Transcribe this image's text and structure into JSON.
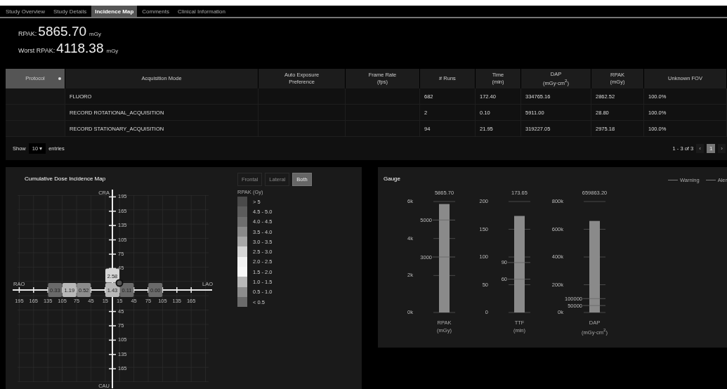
{
  "tabs": [
    {
      "label": "Study Overview",
      "selected": false
    },
    {
      "label": "Study Details",
      "selected": false
    },
    {
      "label": "Incidence Map",
      "selected": true
    },
    {
      "label": "Comments",
      "selected": false
    },
    {
      "label": "Clinical Information",
      "selected": false
    }
  ],
  "summary": [
    {
      "label": "RPAK:",
      "value": "5865.70",
      "unit": "mGy"
    },
    {
      "label": "Worst RPAK:",
      "value": "4118.38",
      "unit": "mGy"
    }
  ],
  "table": {
    "columns": [
      {
        "label": "Protocol",
        "sorted": true
      },
      {
        "label": "Acquisition Mode",
        "sorted": false
      },
      {
        "label": "Auto Exposure\nPreference",
        "sorted": false
      },
      {
        "label": "Frame Rate\n(fps)",
        "sorted": false
      },
      {
        "label": "# Runs",
        "sorted": false
      },
      {
        "label": "Time\n(min)",
        "sorted": false
      },
      {
        "label": "DAP\n(mGy·cm$^{2}$)",
        "sorted": false
      },
      {
        "label": "RPAK\n(mGy)",
        "sorted": false
      },
      {
        "label": "Unknown FOV",
        "sorted": false
      }
    ],
    "rows": [
      {
        "cells": [
          null,
          "FLUORO",
          null,
          null,
          "682",
          "172.40",
          "334765.16",
          "2862.52",
          "100.0%"
        ]
      },
      {
        "cells": [
          null,
          "RECORD ROTATIONAL_ACQUISITION",
          null,
          null,
          "2",
          "0.10",
          "5911.00",
          "28.80",
          "100.0%"
        ]
      },
      {
        "cells": [
          null,
          "RECORD STATIONARY_ACQUISITION",
          null,
          null,
          "94",
          "21.95",
          "319227.05",
          "2975.18",
          "100.0%"
        ]
      }
    ]
  },
  "page_length": {
    "label_before": "Show",
    "value": "10",
    "caret": "▾",
    "label_after": "entries"
  },
  "pagination": {
    "info": "1 - 3 of 3",
    "prev": "‹",
    "pages": [
      {
        "label": "1",
        "selected": true
      }
    ],
    "next": "›"
  },
  "incidence_map": {
    "title": "Cumulative Dose Incidence Map",
    "views": [
      {
        "label": "Frontal",
        "selected": false
      },
      {
        "label": "Lateral",
        "selected": false
      },
      {
        "label": "Both",
        "selected": true
      }
    ],
    "axis_labels": {
      "left": "RAO",
      "right": "LAO",
      "top": "CRA",
      "bottom": "CAU"
    },
    "horizontal_ticks": [
      "195",
      "165",
      "135",
      "105",
      "75",
      "45",
      "15",
      "15",
      "45",
      "75",
      "105",
      "135",
      "165"
    ],
    "upper_ticks": [
      "195",
      "165",
      "135",
      "105",
      "75",
      "45"
    ],
    "lower_ticks": [
      "45",
      "75",
      "105",
      "135",
      "165"
    ],
    "horizontal_cells": [
      null,
      null,
      {
        "value": "0.33",
        "color": "#6a6a6a"
      },
      {
        "value": "1.19",
        "color": "#b8b8b8"
      },
      {
        "value": "0.52",
        "color": "#8c8c8c"
      },
      null,
      {
        "value": "1.43",
        "color": "#b8b8b8"
      },
      {
        "value": "0.11",
        "color": "#6a6a6a"
      },
      null,
      {
        "value": "0.00",
        "color": "#6a6a6a"
      },
      null,
      null
    ],
    "upper_cells": [
      {
        "value": "2.58",
        "color": "#d6d6d6"
      }
    ],
    "legend": {
      "title": "RPAK (Gy)",
      "items": [
        {
          "label": "> 5",
          "color": "#4a4a4a"
        },
        {
          "label": "4.5 - 5.0",
          "color": "#5c5c5c"
        },
        {
          "label": "4.0 - 4.5",
          "color": "#6e6e6e"
        },
        {
          "label": "3.5 - 4.0",
          "color": "#8a8a8a"
        },
        {
          "label": "3.0 - 3.5",
          "color": "#a8a8a8"
        },
        {
          "label": "2.5 - 3.0",
          "color": "#d6d6d6"
        },
        {
          "label": "2.0 - 2.5",
          "color": "#f2f2f2"
        },
        {
          "label": "1.5 - 2.0",
          "color": "#f8f8f8"
        },
        {
          "label": "1.0 - 1.5",
          "color": "#b8b8b8"
        },
        {
          "label": "0.5 - 1.0",
          "color": "#8c8c8c"
        },
        {
          "label": "< 0.5",
          "color": "#6a6a6a"
        }
      ]
    }
  },
  "gauge": {
    "title": "Gauge",
    "legend": [
      "Warning",
      "Aler"
    ],
    "gauges": [
      {
        "chart_data": {
          "type": "bar",
          "title": "5865.70",
          "categories": [
            "RPAK\n(mGy)"
          ],
          "values": [
            5866
          ],
          "ylim": [
            0,
            6000
          ],
          "yticks": [
            {
              "value": 0,
              "label": "0k"
            },
            {
              "value": 2000,
              "label": "2k"
            },
            {
              "value": 4000,
              "label": "4k"
            },
            {
              "value": 6000,
              "label": "6k"
            }
          ],
          "grid": true,
          "ref_lines": [
            {
              "axis": "y",
              "value": 5000,
              "label": "5000"
            },
            {
              "axis": "y",
              "value": 3000,
              "label": "3000"
            }
          ]
        }
      },
      {
        "chart_data": {
          "type": "bar",
          "title": "173.65",
          "categories": [
            "TTF\n(min)"
          ],
          "values": [
            174
          ],
          "ylim": [
            0,
            200
          ],
          "yticks": [
            0,
            50,
            100,
            150,
            200
          ],
          "grid": true,
          "ref_lines": [
            {
              "axis": "y",
              "value": 90,
              "label": "90"
            },
            {
              "axis": "y",
              "value": 60,
              "label": "60"
            }
          ]
        }
      },
      {
        "chart_data": {
          "type": "bar",
          "title": "659863.20",
          "categories": [
            "DAP\n(mGy·cm$^{2}$)"
          ],
          "values": [
            660000
          ],
          "ylim": [
            0,
            800000
          ],
          "yticks": [
            {
              "value": 0,
              "label": "0k"
            },
            {
              "value": 200000,
              "label": "200k"
            },
            {
              "value": 400000,
              "label": "400k"
            },
            {
              "value": 600000,
              "label": "600k"
            },
            {
              "value": 800000,
              "label": "800k"
            }
          ],
          "grid": true,
          "ref_lines": [
            {
              "axis": "y",
              "value": 100000,
              "label": "100000"
            },
            {
              "axis": "y",
              "value": 50000,
              "label": "50000"
            }
          ]
        }
      }
    ]
  }
}
